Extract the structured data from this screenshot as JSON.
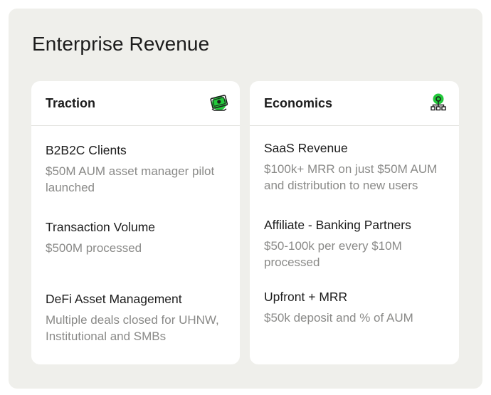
{
  "page": {
    "title": "Enterprise Revenue"
  },
  "traction": {
    "title": "Traction",
    "icon": "money-icon",
    "items": [
      {
        "title": "B2B2C Clients",
        "description": "$50M AUM asset manager pilot launched"
      },
      {
        "title": "Transaction Volume",
        "description": "$500M processed"
      },
      {
        "title": "DeFi Asset Management",
        "description": "Multiple deals closed for UHNW, Institutional and SMBs"
      }
    ]
  },
  "economics": {
    "title": "Economics",
    "icon": "network-icon",
    "items": [
      {
        "title": "SaaS Revenue",
        "description": "$100k+ MRR on just $50M AUM and distribution to new users"
      },
      {
        "title": "Affiliate - Banking Partners",
        "description": "$50-100k per every $10M processed"
      },
      {
        "title": "Upfront + MRR",
        "description": "$50k deposit and % of AUM"
      }
    ]
  },
  "colors": {
    "accent": "#22c93a",
    "background": "#efefeb",
    "card": "#ffffff",
    "muted_text": "#8a8a88"
  }
}
